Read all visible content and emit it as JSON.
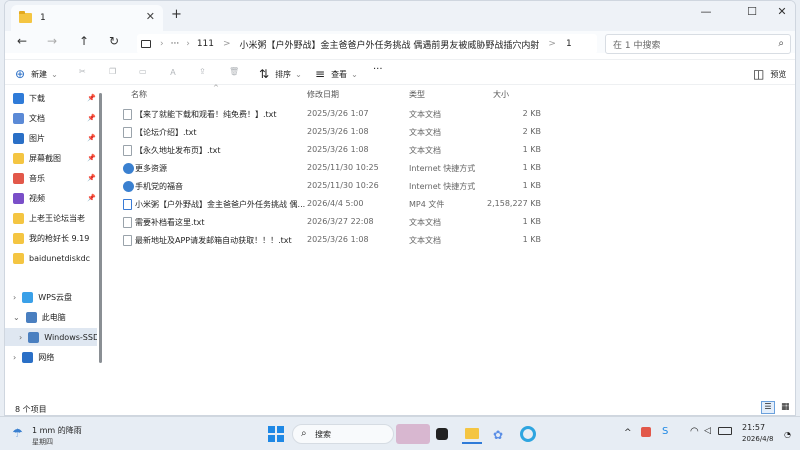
{
  "tab": {
    "title": "1",
    "close": "✕",
    "new": "+"
  },
  "window": {
    "minimize": "—",
    "maximize": "☐",
    "close": "✕"
  },
  "address": {
    "more": "···",
    "segments": [
      "111",
      "小米粥【户外野战】金主爸爸户外任务挑战 偶遇前男友被威胁野战插穴内射",
      "1"
    ],
    "sep": ">",
    "search_placeholder": "在 1 中搜索"
  },
  "toolbar": {
    "new": "新建",
    "sort": "排序",
    "view": "查看",
    "more": "···",
    "preview": "预览"
  },
  "sidebar": {
    "items": [
      {
        "label": "下载",
        "icon": "download-icon",
        "color": "#2f7bd8"
      },
      {
        "label": "文档",
        "icon": "document-icon",
        "color": "#5b8ad6"
      },
      {
        "label": "图片",
        "icon": "picture-icon",
        "color": "#2a6fc6"
      },
      {
        "label": "屏幕截图",
        "icon": "folder-icon",
        "color": "#f4c542"
      },
      {
        "label": "音乐",
        "icon": "music-icon",
        "color": "#e2584a"
      },
      {
        "label": "视频",
        "icon": "video-icon",
        "color": "#7a4fc8"
      },
      {
        "label": "上老王论坛当老",
        "icon": "folder-icon",
        "color": "#f4c542"
      },
      {
        "label": "我的枪好长 9.19",
        "icon": "folder-icon",
        "color": "#f4c542"
      },
      {
        "label": "baidunetdiskdc",
        "icon": "folder-icon",
        "color": "#f4c542"
      }
    ],
    "tree": [
      {
        "label": "WPS云盘",
        "icon": "cloud-icon"
      },
      {
        "label": "此电脑",
        "icon": "computer-icon"
      },
      {
        "label": "Windows-SSD",
        "icon": "drive-icon"
      },
      {
        "label": "网络",
        "icon": "network-icon"
      }
    ]
  },
  "columns": [
    "名称",
    "修改日期",
    "类型",
    "大小"
  ],
  "files": [
    {
      "name": "【来了就能下载和观看！纯免费！】.txt",
      "date": "2025/3/26 1:07",
      "type": "文本文档",
      "size": "2 KB",
      "icon": "text-file-icon"
    },
    {
      "name": "【论坛介绍】.txt",
      "date": "2025/3/26 1:08",
      "type": "文本文档",
      "size": "2 KB",
      "icon": "text-file-icon"
    },
    {
      "name": "【永久地址发布页】.txt",
      "date": "2025/3/26 1:08",
      "type": "文本文档",
      "size": "1 KB",
      "icon": "text-file-icon"
    },
    {
      "name": "更多资源",
      "date": "2025/11/30 10:25",
      "type": "Internet 快捷方式",
      "size": "1 KB",
      "icon": "internet-shortcut-icon"
    },
    {
      "name": "手机党的福音",
      "date": "2025/11/30 10:26",
      "type": "Internet 快捷方式",
      "size": "1 KB",
      "icon": "internet-shortcut-icon"
    },
    {
      "name": "小米粥【户外野战】金主爸爸户外任务挑战 偶...",
      "date": "2026/4/4 5:00",
      "type": "MP4 文件",
      "size": "2,158,227 KB",
      "icon": "video-file-icon"
    },
    {
      "name": "需要补档看这里.txt",
      "date": "2026/3/27 22:08",
      "type": "文本文档",
      "size": "1 KB",
      "icon": "text-file-icon"
    },
    {
      "name": "最新地址及APP请发邮箱自动获取！！！.txt",
      "date": "2025/3/26 1:08",
      "type": "文本文档",
      "size": "1 KB",
      "icon": "text-file-icon"
    }
  ],
  "status": {
    "count": "8 个项目"
  },
  "taskbar": {
    "weather": "1 mm 的降雨",
    "weather_sub": "星期四",
    "search": "搜索",
    "time": "21:57",
    "date": "2026/4/8"
  }
}
